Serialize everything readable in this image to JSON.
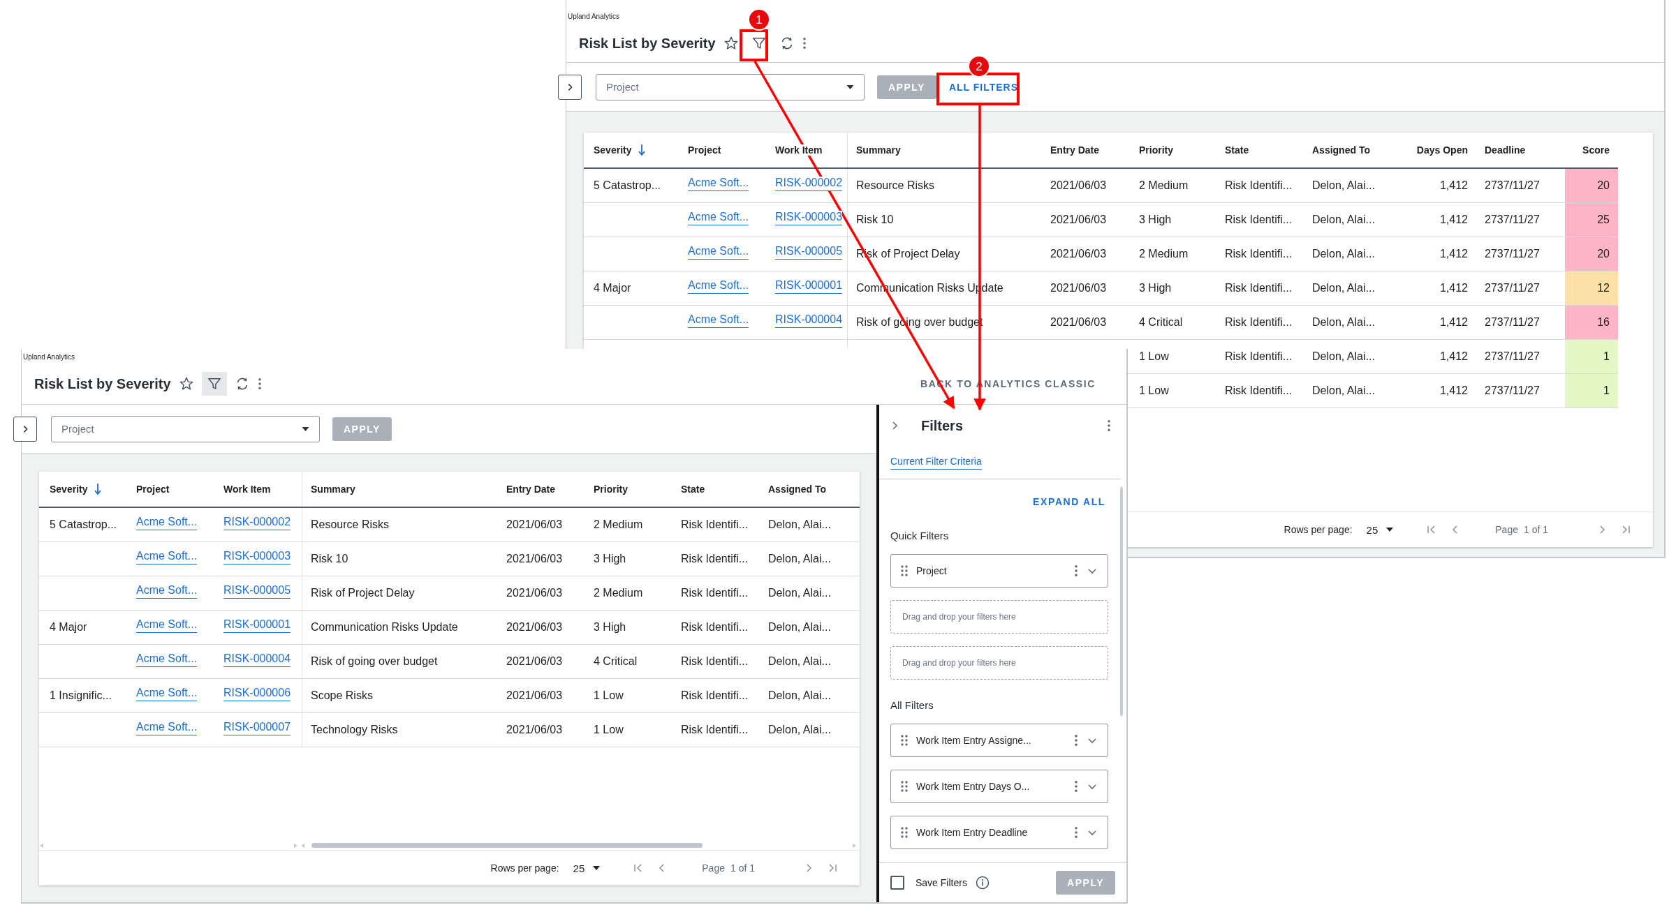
{
  "back_window": {
    "app_name": "Upland Analytics",
    "title": "Risk List by Severity",
    "filter_active": false,
    "project_filter": {
      "placeholder": "Project"
    },
    "apply_button": {
      "label": "APPLY",
      "disabled": true
    },
    "all_filters_button": {
      "label": "ALL FILTERS"
    },
    "table": {
      "columns": [
        {
          "label": "Severity",
          "kind": "text",
          "sorted": true
        },
        {
          "label": "Project",
          "kind": "link",
          "sorted": false
        },
        {
          "label": "Work Item",
          "kind": "link",
          "sorted": false
        },
        {
          "label": "Summary",
          "kind": "text",
          "sorted": false
        },
        {
          "label": "Entry Date",
          "kind": "text",
          "sorted": false
        },
        {
          "label": "Priority",
          "kind": "text",
          "sorted": false
        },
        {
          "label": "State",
          "kind": "text",
          "sorted": false
        },
        {
          "label": "Assigned To",
          "kind": "text",
          "sorted": false
        },
        {
          "label": "Days Open",
          "kind": "number",
          "sorted": false
        },
        {
          "label": "Deadline",
          "kind": "text",
          "sorted": false
        },
        {
          "label": "Score",
          "kind": "score",
          "sorted": false
        }
      ],
      "rows": [
        {
          "cells": [
            "5 Catastrop...",
            "Acme Soft...",
            "RISK-000002",
            "Resource Risks",
            "2021/06/03",
            "2 Medium",
            "Risk Identifi...",
            "Delon, Alai...",
            "1,412",
            "2737/11/27",
            "20"
          ],
          "color": "#ffb5c8"
        },
        {
          "cells": [
            "Acme Soft...",
            "RISK-000003",
            "Risk 10",
            "2021/06/03",
            "3 High",
            "Risk Identifi...",
            "Delon, Alai...",
            "1,412",
            "2737/11/27",
            "25"
          ],
          "color": "#ffb5c8"
        },
        {
          "cells": [
            "Acme Soft...",
            "RISK-000005",
            "Risk of Project Delay",
            "2021/06/03",
            "2 Medium",
            "Risk Identifi...",
            "Delon, Alai...",
            "1,412",
            "2737/11/27",
            "20"
          ],
          "color": "#ffb5c8"
        },
        {
          "cells": [
            "4 Major",
            "Acme Soft...",
            "RISK-000001",
            "Communication Risks Update",
            "2021/06/03",
            "3 High",
            "Risk Identifi...",
            "Delon, Alai...",
            "1,412",
            "2737/11/27",
            "12"
          ],
          "color": "#fde0a5"
        },
        {
          "cells": [
            "Acme Soft...",
            "RISK-000004",
            "Risk of going over budget",
            "2021/06/03",
            "4 Critical",
            "Risk Identifi...",
            "Delon, Alai...",
            "1,412",
            "2737/11/27",
            "16"
          ],
          "color": "#ffb5c8"
        },
        {
          "cells": [
            "1 Low",
            "Risk Identifi...",
            "Delon, Alai...",
            "1,412",
            "2737/11/27",
            "1"
          ],
          "color": "#e3f8c5"
        },
        {
          "cells": [
            "1 Low",
            "Risk Identifi...",
            "Delon, Alai...",
            "1,412",
            "2737/11/27",
            "1"
          ],
          "color": "#e3f8c5"
        }
      ]
    },
    "pagination": {
      "rows_per_page_label": "Rows per page:",
      "rows_per_page": "25",
      "page_label": "Page",
      "page_value": "1 of 1"
    }
  },
  "front_window": {
    "app_name": "Upland Analytics",
    "title": "Risk List by Severity",
    "filter_active": true,
    "back_link": "BACK TO ANALYTICS CLASSIC",
    "project_filter": {
      "placeholder": "Project"
    },
    "apply_button": {
      "label": "APPLY",
      "disabled": true
    },
    "table": {
      "columns": [
        {
          "label": "Severity",
          "kind": "text",
          "sorted": true
        },
        {
          "label": "Project",
          "kind": "link",
          "sorted": false
        },
        {
          "label": "Work Item",
          "kind": "link",
          "sorted": false
        },
        {
          "label": "Summary",
          "kind": "text",
          "sorted": false
        },
        {
          "label": "Entry Date",
          "kind": "text",
          "sorted": false
        },
        {
          "label": "Priority",
          "kind": "text",
          "sorted": false
        },
        {
          "label": "State",
          "kind": "text",
          "sorted": false
        },
        {
          "label": "Assigned To",
          "kind": "text",
          "sorted": false
        }
      ],
      "rows": [
        {
          "cells": [
            "5 Catastrop...",
            "Acme Soft...",
            "RISK-000002",
            "Resource Risks",
            "2021/06/03",
            "2 Medium",
            "Risk Identifi...",
            "Delon, Alai..."
          ]
        },
        {
          "cells": [
            "Acme Soft...",
            "RISK-000003",
            "Risk 10",
            "2021/06/03",
            "3 High",
            "Risk Identifi...",
            "Delon, Alai..."
          ]
        },
        {
          "cells": [
            "Acme Soft...",
            "RISK-000005",
            "Risk of Project Delay",
            "2021/06/03",
            "2 Medium",
            "Risk Identifi...",
            "Delon, Alai..."
          ]
        },
        {
          "cells": [
            "4 Major",
            "Acme Soft...",
            "RISK-000001",
            "Communication Risks Update",
            "2021/06/03",
            "3 High",
            "Risk Identifi...",
            "Delon, Alai..."
          ]
        },
        {
          "cells": [
            "Acme Soft...",
            "RISK-000004",
            "Risk of going over budget",
            "2021/06/03",
            "4 Critical",
            "Risk Identifi...",
            "Delon, Alai..."
          ]
        },
        {
          "cells": [
            "1 Insignific...",
            "Acme Soft...",
            "RISK-000006",
            "Scope Risks",
            "2021/06/03",
            "1 Low",
            "Risk Identifi...",
            "Delon, Alai..."
          ]
        },
        {
          "cells": [
            "Acme Soft...",
            "RISK-000007",
            "Technology Risks",
            "2021/06/03",
            "1 Low",
            "Risk Identifi...",
            "Delon, Alai..."
          ]
        }
      ]
    },
    "pagination": {
      "rows_per_page_label": "Rows per page:",
      "rows_per_page": "25",
      "page_label": "Page",
      "page_value": "1 of 1"
    },
    "filters_panel": {
      "title": "Filters",
      "tab": "Current Filter Criteria",
      "expand_all": "EXPAND ALL",
      "sections": [
        {
          "title": "Quick Filters",
          "items": [
            {
              "kind": "filter",
              "label": "Project"
            },
            {
              "kind": "dropzone",
              "label": "Drag and drop your filters here"
            },
            {
              "kind": "dropzone",
              "label": "Drag and drop your filters here"
            }
          ]
        },
        {
          "title": "All Filters",
          "items": [
            {
              "kind": "filter",
              "label": "Work Item Entry Assigne..."
            },
            {
              "kind": "filter",
              "label": "Work Item Entry Days O..."
            },
            {
              "kind": "filter",
              "label": "Work Item Entry Deadline"
            }
          ]
        }
      ],
      "save_filters": {
        "label": "Save Filters",
        "checked": false
      },
      "apply_button": {
        "label": "APPLY",
        "disabled": true
      }
    }
  },
  "annotations": [
    {
      "number": "1"
    },
    {
      "number": "2"
    }
  ]
}
